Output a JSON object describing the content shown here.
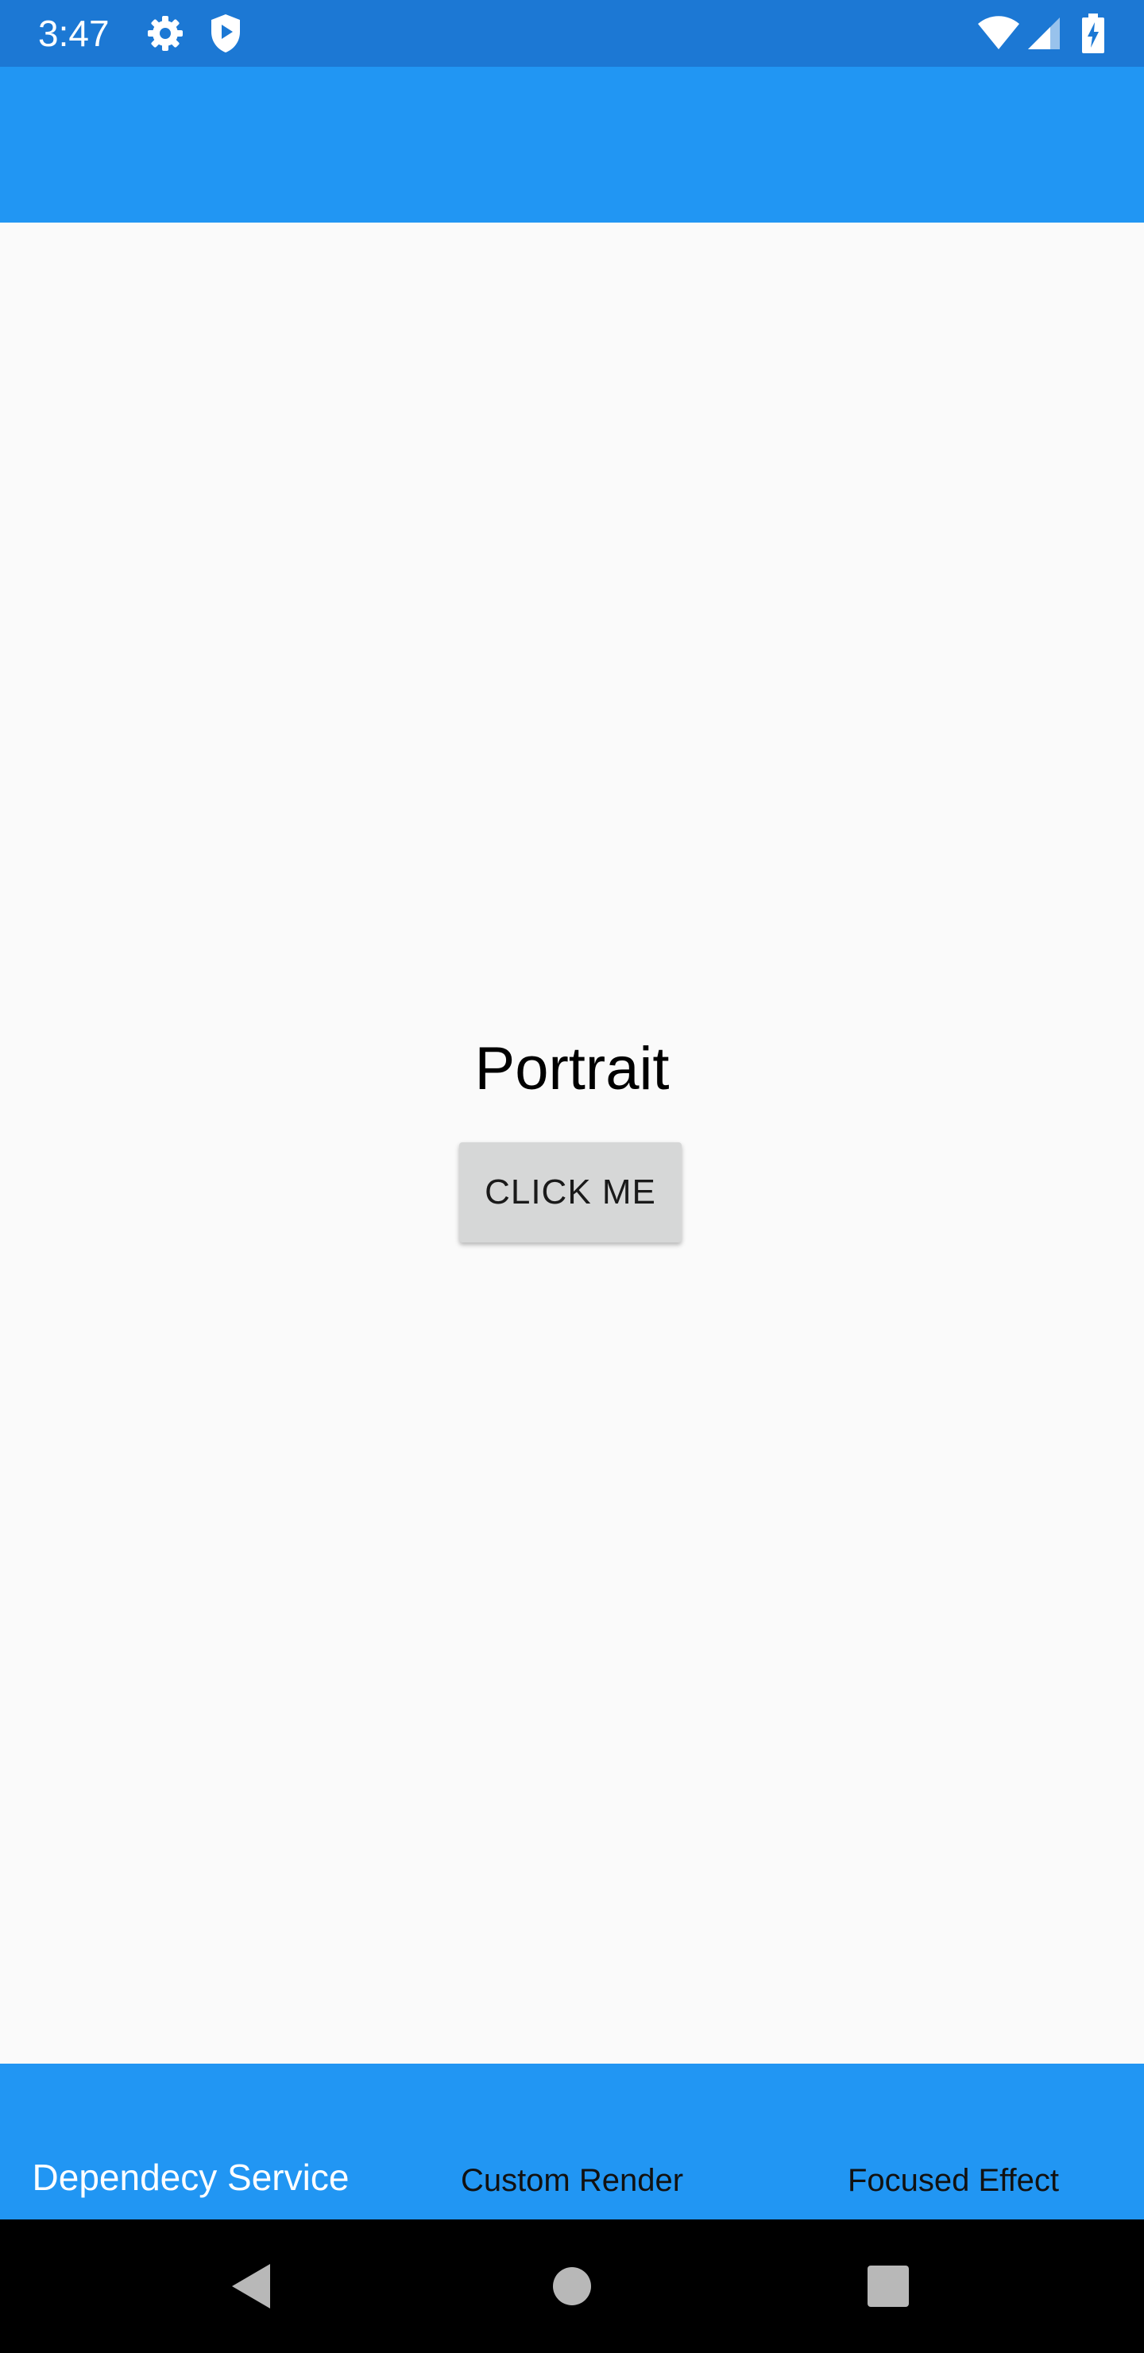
{
  "status_bar": {
    "time": "3:47",
    "icons": [
      "gear-icon",
      "shield-play-icon",
      "wifi-icon",
      "cell-signal-icon",
      "battery-charging-icon"
    ]
  },
  "main": {
    "orientation_label": "Portrait",
    "button_label": "CLICK ME"
  },
  "tabs": [
    {
      "label": "Dependecy Service",
      "selected": true
    },
    {
      "label": "Custom Render",
      "selected": false
    },
    {
      "label": "Focused Effect",
      "selected": false
    }
  ],
  "nav_bar": {
    "buttons": [
      "back-icon",
      "home-icon",
      "recents-icon"
    ]
  },
  "colors": {
    "status_bar": "#1c78d4",
    "primary": "#2196f3",
    "background": "#fafafa",
    "button": "#d6d7d7",
    "nav_bar": "#000000"
  }
}
